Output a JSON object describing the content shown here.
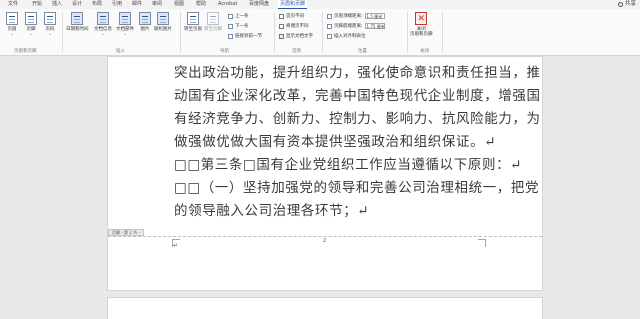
{
  "tabs": [
    "文件",
    "开始",
    "插入",
    "设计",
    "布局",
    "引用",
    "邮件",
    "审阅",
    "视图",
    "帮助",
    "Acrobat",
    "百度网盘",
    "页眉和页脚"
  ],
  "share_label": "共享",
  "ribbon": {
    "header_footer_group": {
      "label": "页眉和页脚",
      "buttons": [
        "页眉",
        "页脚",
        "页码"
      ]
    },
    "insert_group": {
      "label": "插入",
      "buttons": [
        "日期和时间",
        "文档信息",
        "文档部件",
        "图片",
        "联机图片"
      ]
    },
    "nav_group": {
      "label": "导航",
      "goto_header": "转至页眉",
      "goto_footer": "转至页脚",
      "prev": "上一条",
      "next": "下一条",
      "link_prev": "链接到前一节"
    },
    "options_group": {
      "label": "选项",
      "diff_first": "首页不同",
      "diff_odd_even": "奇偶页不同",
      "show_doc_text": "显示文档文字",
      "show_doc_text_check": "✓"
    },
    "position_group": {
      "label": "位置",
      "header_from_top": "页眉顶端距离:",
      "header_from_top_value": "1.5 厘米",
      "footer_from_bottom": "页脚底端距离:",
      "footer_from_bottom_value": "1.75 厘米",
      "insert_align_tab": "插入对齐制表位"
    },
    "close_group": {
      "label": "关闭",
      "close_btn": "关闭\n页眉和页脚"
    }
  },
  "document": {
    "lines": [
      "突出政治功能，提升组织力，强化使命意识和责任担当，推",
      "动国有企业深化改革，完善中国特色现代企业制度，增强国",
      "有经济竞争力、创新力、控制力、影响力、抗风险能力，为",
      "做强做优做大国有资本提供坚强政治和组织保证。↵",
      "□□第三条□国有企业党组织工作应当遵循以下原则：↵",
      "□□（一）坚持加强党的领导和完善公司治理相统一，把党",
      "的领导融入公司治理各环节；↵"
    ],
    "footer_tag": "页脚 - 第 2 节 -",
    "page_number": "2",
    "footer_mark": "↵"
  }
}
